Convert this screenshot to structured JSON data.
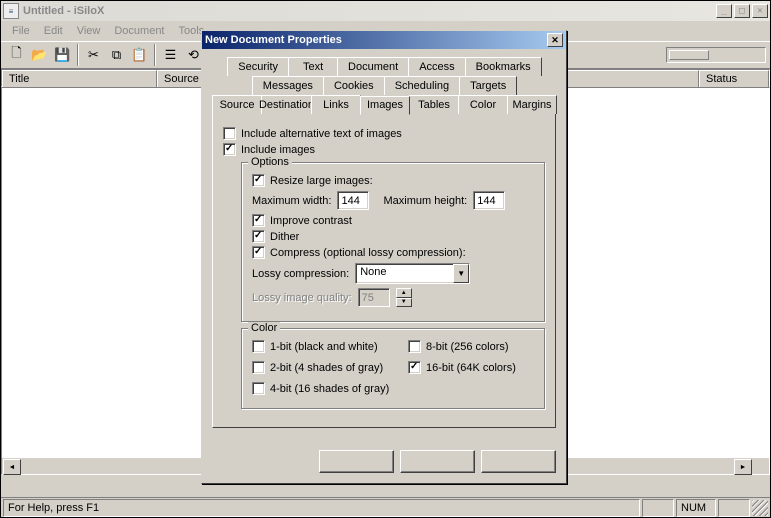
{
  "window": {
    "title": "Untitled - iSiloX"
  },
  "menu": [
    "File",
    "Edit",
    "View",
    "Document",
    "Tools"
  ],
  "columns": {
    "title": "Title",
    "source": "Source",
    "last": "",
    "status": "Status"
  },
  "statusbar": {
    "help": "For Help, press F1",
    "num": "NUM"
  },
  "dialog": {
    "title": "New Document Properties",
    "tabs_row1": [
      "Security",
      "Text",
      "Document",
      "Access",
      "Bookmarks"
    ],
    "tabs_row2": [
      "Messages",
      "Cookies",
      "Scheduling",
      "Targets"
    ],
    "tabs_row3": [
      "Source",
      "Destination",
      "Links",
      "Images",
      "Tables",
      "Color",
      "Margins"
    ],
    "active_tab": "Images",
    "include_alt": "Include alternative text of images",
    "include_images": "Include images",
    "options_legend": "Options",
    "resize": "Resize large images:",
    "max_w_label": "Maximum width:",
    "max_w": "144",
    "max_h_label": "Maximum height:",
    "max_h": "144",
    "improve": "Improve contrast",
    "dither": "Dither",
    "compress": "Compress (optional lossy compression):",
    "lossy_label": "Lossy compression:",
    "lossy_value": "None",
    "quality_label": "Lossy image quality:",
    "quality_value": "75",
    "color_legend": "Color",
    "c1": "1-bit (black and white)",
    "c2": "2-bit (4 shades of gray)",
    "c4": "4-bit (16 shades of gray)",
    "c8": "8-bit (256 colors)",
    "c16": "16-bit (64K colors)"
  }
}
